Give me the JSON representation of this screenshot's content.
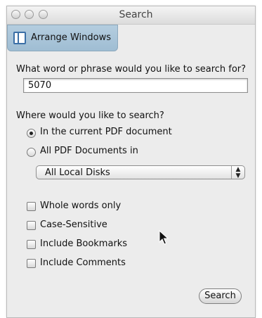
{
  "window": {
    "title": "Search"
  },
  "toolbar": {
    "arrange_label": "Arrange Windows"
  },
  "query": {
    "prompt": "What word or phrase would you like to search for?",
    "value": "5070"
  },
  "location": {
    "prompt": "Where would you like to search?",
    "options": [
      {
        "label": "In the current PDF document",
        "selected": true
      },
      {
        "label": "All PDF Documents in",
        "selected": false
      }
    ],
    "popup_value": "All Local Disks"
  },
  "options": [
    {
      "label": "Whole words only",
      "checked": false
    },
    {
      "label": "Case-Sensitive",
      "checked": false
    },
    {
      "label": "Include Bookmarks",
      "checked": false
    },
    {
      "label": "Include Comments",
      "checked": false
    }
  ],
  "actions": {
    "search_label": "Search"
  },
  "icons": {
    "arrange": "arrange-windows-icon",
    "popup": "up-down-arrows-icon",
    "cursor": "mouse-pointer-icon"
  }
}
